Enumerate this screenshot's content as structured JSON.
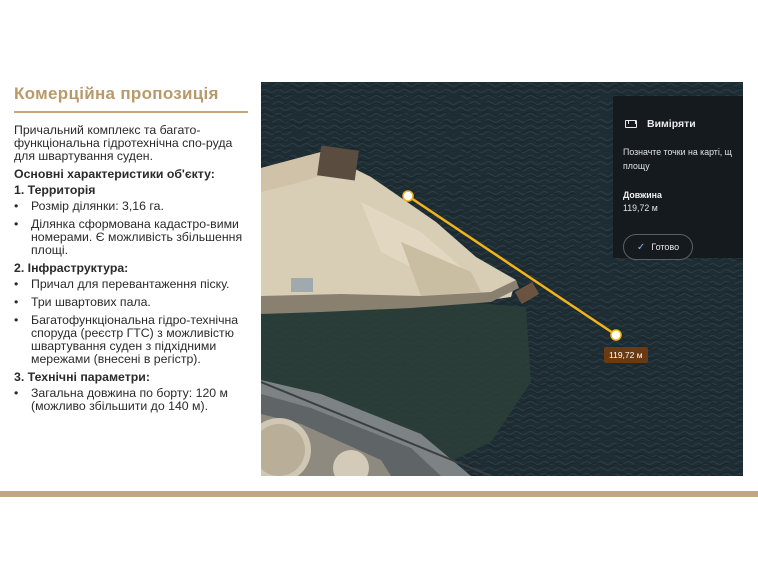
{
  "slide": {
    "title": "Комерційна пропозиція",
    "intro": "Причальний комплекс та багато-функціональна гідротехнічна спо-руда для швартування суден.",
    "main_heading": "Основні характеристики об'єкту:",
    "sections": [
      {
        "heading": "1. Территорія",
        "items": [
          "Розмір ділянки: 3,16 га.",
          "Ділянка сформована кадастро-вими номерами. Є можливість збільшення площі."
        ]
      },
      {
        "heading": "2. Інфраструктура:",
        "items": [
          "Причал для перевантаження піску.",
          "Три швартових пала.",
          "Багатофункціональна гідро-технічна споруда (реєстр ГТС) з можливістю швартування суден з підхідними мережами (внесені в регістр)."
        ]
      },
      {
        "heading": "3. Технічні параметри:",
        "items": [
          "Загальна довжина по борту: 120 м (можливо збільшити до 140 м)."
        ]
      }
    ],
    "bullet": "•"
  },
  "map": {
    "measure_panel": {
      "title": "Виміряти",
      "instruction_line1": "Позначте точки на карті, щ",
      "instruction_line2": "площу",
      "length_label": "Довжина",
      "length_value": "119,72 м",
      "done_label": "Готово",
      "done_icon": "✓"
    },
    "distance_label": "119,72 м",
    "line_color": "#f2b31b"
  },
  "colors": {
    "accent": "#b89a6a",
    "rule": "#c4a67a",
    "footer": "#c2a67d"
  }
}
